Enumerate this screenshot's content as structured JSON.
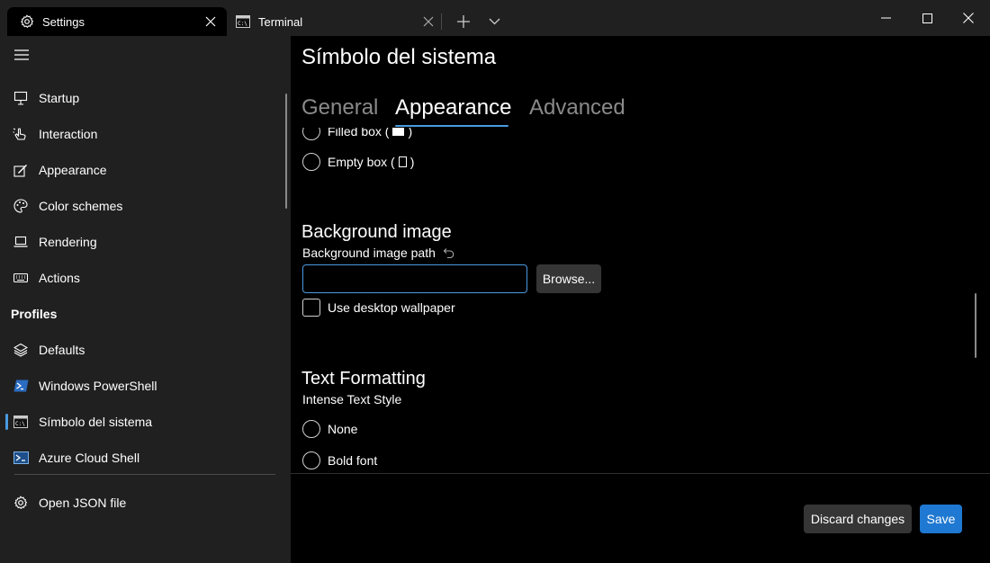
{
  "tabs": [
    {
      "title": "Settings",
      "icon": "gear-icon"
    },
    {
      "title": "Terminal",
      "icon": "command-prompt-icon"
    }
  ],
  "sidebar": {
    "items": [
      {
        "label": "Startup",
        "icon": "startup-icon"
      },
      {
        "label": "Interaction",
        "icon": "interaction-icon"
      },
      {
        "label": "Appearance",
        "icon": "appearance-icon"
      },
      {
        "label": "Color schemes",
        "icon": "palette-icon"
      },
      {
        "label": "Rendering",
        "icon": "rendering-icon"
      },
      {
        "label": "Actions",
        "icon": "keyboard-icon"
      }
    ],
    "profiles_header": "Profiles",
    "profiles": [
      {
        "label": "Defaults",
        "icon": "layers-icon"
      },
      {
        "label": "Windows PowerShell",
        "icon": "powershell-icon"
      },
      {
        "label": "Símbolo del sistema",
        "icon": "command-prompt-icon",
        "selected": true
      },
      {
        "label": "Azure Cloud Shell",
        "icon": "azure-icon"
      }
    ],
    "open_json": "Open JSON file"
  },
  "main": {
    "title": "Símbolo del sistema",
    "pivots": [
      "General",
      "Appearance",
      "Advanced"
    ],
    "active_pivot": "Appearance",
    "cursor_options": {
      "filled_box": "Filled box (",
      "filled_box_end": ")",
      "empty_box": "Empty box (",
      "empty_box_end": ")"
    },
    "background_image": {
      "title": "Background image",
      "path_label": "Background image path",
      "path_value": "",
      "browse": "Browse...",
      "use_wallpaper": "Use desktop wallpaper"
    },
    "text_formatting": {
      "title": "Text Formatting",
      "intense_label": "Intense Text Style",
      "options": [
        "None",
        "Bold font"
      ]
    },
    "footer": {
      "discard": "Discard changes",
      "save": "Save"
    }
  },
  "colors": {
    "accent": "#4a9ae0",
    "save_button": "#1f78d1",
    "sidebar_bg": "#202020",
    "content_bg": "#000000"
  }
}
